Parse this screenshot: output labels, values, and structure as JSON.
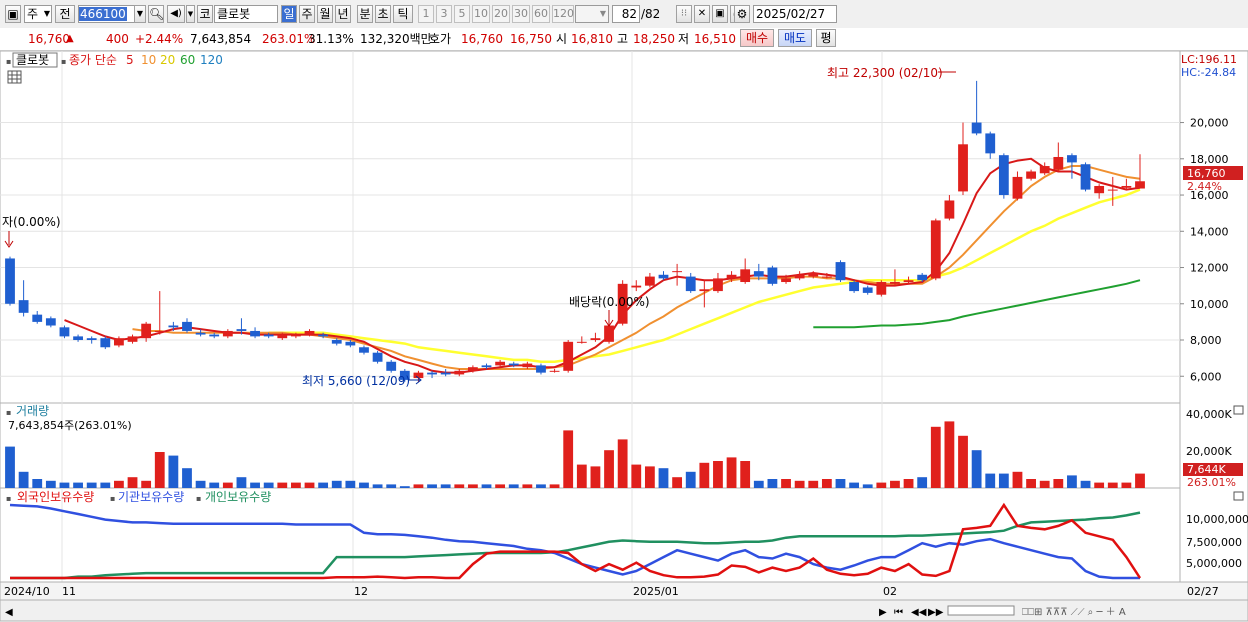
{
  "toolbar": {
    "type_select": "주",
    "prev_label": "전",
    "code_input": "466100",
    "market_label": "코",
    "stock_name": "클로봇",
    "periods": [
      "일",
      "주",
      "월",
      "년",
      "분",
      "초",
      "틱"
    ],
    "intervals": [
      "1",
      "3",
      "5",
      "10",
      "20",
      "30",
      "60",
      "120"
    ],
    "count_display": "82",
    "count_total": "/82",
    "date_value": "2025/02/27"
  },
  "quote": {
    "price": "16,760",
    "change": "400",
    "change_pct": "+2.44%",
    "volume": "7,643,854",
    "volume_ratio": "263.01%",
    "turnover": "31.13%",
    "amount": "132,320백만",
    "bid_label": "호가",
    "ask": "16,760",
    "bid": "16,750",
    "open_label": "시",
    "open": "16,810",
    "high_label": "고",
    "high": "18,250",
    "low_label": "저",
    "low": "16,510",
    "buy_btn": "매수",
    "sell_btn": "매도",
    "eval_btn": "평"
  },
  "legend": {
    "name": "클로봇",
    "ma_prefix": "종가 단순",
    "ma5": "5",
    "ma10": "10",
    "ma20": "20",
    "ma60": "60",
    "ma120": "120"
  },
  "annotations": {
    "high_note": "최고 22,300 (02/10)",
    "low_note": "최저 5,660 (12/09)",
    "dividend_note": "배당락(0.00%)",
    "left_note": "자(0.00%)",
    "lc": "LC:196.11",
    "hc": "HC:-24.84",
    "price_tag": "16,760",
    "pct_tag": "2.44%"
  },
  "price_axis": [
    "20,000",
    "18,000",
    "16,000",
    "14,000",
    "12,000",
    "10,000",
    "8,000",
    "6,000"
  ],
  "volume_panel": {
    "title": "거래량",
    "value": "7,643,854주(263.01%)",
    "axis": [
      "40,000K",
      "20,000K"
    ],
    "tag": "7,644K",
    "tag_pct": "263.01%"
  },
  "holding_panel": {
    "foreign": "외국인보유수량",
    "institution": "기관보유수량",
    "individual": "개인보유수량",
    "axis": [
      "10,000,000",
      "7,500,000",
      "5,000,000"
    ]
  },
  "date_axis": [
    "2024/10",
    "11",
    "12",
    "2025/01",
    "02"
  ],
  "date_end": "02/27",
  "colors": {
    "up": "#e0201c",
    "down": "#1f5fd0",
    "ma5": "#d81818",
    "ma10": "#f09030",
    "ma20": "#ffff30",
    "ma60": "#20a030",
    "foreign": "#e01010",
    "institution": "#3050e0",
    "individual": "#209060"
  },
  "chart_data": {
    "type": "candlestick",
    "ylim": [
      4800,
      22900
    ],
    "candles": [
      [
        12500,
        10000,
        9900,
        12600
      ],
      [
        10200,
        9500,
        9300,
        11300
      ],
      [
        9400,
        9000,
        8900,
        9600
      ],
      [
        9200,
        8800,
        8700,
        9300
      ],
      [
        8700,
        8200,
        8100,
        8800
      ],
      [
        8200,
        8000,
        7900,
        8300
      ],
      [
        8100,
        8000,
        7800,
        8200
      ],
      [
        8100,
        7600,
        7500,
        8200
      ],
      [
        7700,
        8100,
        7600,
        8200
      ],
      [
        7900,
        8200,
        7800,
        8300
      ],
      [
        8100,
        8900,
        7900,
        9000
      ],
      [
        8500,
        8500,
        8300,
        10700
      ],
      [
        8800,
        8700,
        8500,
        9000
      ],
      [
        9000,
        8500,
        8400,
        9200
      ],
      [
        8400,
        8300,
        8200,
        8600
      ],
      [
        8300,
        8200,
        8100,
        8400
      ],
      [
        8200,
        8500,
        8100,
        8600
      ],
      [
        8600,
        8500,
        8300,
        9200
      ],
      [
        8500,
        8200,
        8100,
        8700
      ],
      [
        8300,
        8200,
        8100,
        8400
      ],
      [
        8100,
        8300,
        8000,
        8400
      ],
      [
        8200,
        8300,
        8100,
        8400
      ],
      [
        8300,
        8500,
        8200,
        8600
      ],
      [
        8300,
        8200,
        8100,
        8400
      ],
      [
        8000,
        7800,
        7700,
        8100
      ],
      [
        7900,
        7700,
        7600,
        8000
      ],
      [
        7600,
        7300,
        7200,
        7700
      ],
      [
        7300,
        6800,
        6700,
        7400
      ],
      [
        6800,
        6300,
        6200,
        6900
      ],
      [
        6300,
        5800,
        5700,
        6400
      ],
      [
        5900,
        6200,
        5660,
        6300
      ],
      [
        6200,
        6100,
        5900,
        6300
      ],
      [
        6200,
        6100,
        6000,
        6400
      ],
      [
        6100,
        6300,
        6000,
        6400
      ],
      [
        6300,
        6500,
        6200,
        6600
      ],
      [
        6600,
        6500,
        6400,
        6700
      ],
      [
        6600,
        6800,
        6500,
        6900
      ],
      [
        6700,
        6600,
        6500,
        6800
      ],
      [
        6500,
        6700,
        6400,
        6800
      ],
      [
        6600,
        6200,
        6100,
        6700
      ],
      [
        6300,
        6300,
        6200,
        6400
      ],
      [
        6300,
        7900,
        6200,
        8000
      ],
      [
        7900,
        7900,
        7800,
        8200
      ],
      [
        8000,
        8100,
        7900,
        8400
      ],
      [
        7900,
        8800,
        7800,
        8900
      ],
      [
        8900,
        11100,
        8800,
        11300
      ],
      [
        10900,
        11000,
        10700,
        11300
      ],
      [
        11000,
        11500,
        10900,
        11700
      ],
      [
        11600,
        11400,
        11300,
        11800
      ],
      [
        11800,
        11800,
        11000,
        12200
      ],
      [
        11500,
        10700,
        10600,
        11700
      ],
      [
        10700,
        10800,
        9800,
        11300
      ],
      [
        10700,
        11400,
        10600,
        11700
      ],
      [
        11400,
        11600,
        11200,
        11800
      ],
      [
        11200,
        11900,
        11100,
        12500
      ],
      [
        11800,
        11500,
        11300,
        12200
      ],
      [
        12000,
        11100,
        11000,
        12100
      ],
      [
        11200,
        11400,
        11100,
        11600
      ],
      [
        11400,
        11600,
        11300,
        11800
      ],
      [
        11500,
        11700,
        11400,
        11800
      ],
      [
        11500,
        11500,
        11400,
        11700
      ],
      [
        12300,
        11300,
        11200,
        12400
      ],
      [
        11200,
        10700,
        10600,
        11300
      ],
      [
        10900,
        10600,
        10500,
        11000
      ],
      [
        10500,
        11200,
        10400,
        11300
      ],
      [
        11100,
        11200,
        11000,
        11900
      ],
      [
        11200,
        11300,
        11100,
        11500
      ],
      [
        11600,
        11300,
        11200,
        11700
      ],
      [
        11400,
        14600,
        11300,
        14700
      ],
      [
        14700,
        15700,
        14600,
        16000
      ],
      [
        16200,
        18800,
        16000,
        20000
      ],
      [
        20000,
        19400,
        19300,
        22300
      ],
      [
        19400,
        18300,
        18000,
        19500
      ],
      [
        18200,
        16000,
        15800,
        18300
      ],
      [
        15800,
        17000,
        15700,
        17300
      ],
      [
        16900,
        17300,
        16800,
        17400
      ],
      [
        17200,
        17600,
        17100,
        17800
      ],
      [
        17400,
        18100,
        17300,
        18900
      ],
      [
        18200,
        17800,
        16900,
        18300
      ],
      [
        17700,
        16300,
        16200,
        17800
      ],
      [
        16100,
        16500,
        15800,
        16600
      ],
      [
        16300,
        16300,
        15400,
        17000
      ],
      [
        16400,
        16500,
        16300,
        16900
      ],
      [
        16360,
        16760,
        16510,
        18250
      ]
    ],
    "ma5": [
      null,
      null,
      null,
      null,
      9100,
      8800,
      8500,
      8200,
      8000,
      8100,
      8200,
      8400,
      8600,
      8700,
      8600,
      8500,
      8400,
      8400,
      8300,
      8300,
      8300,
      8300,
      8300,
      8300,
      8200,
      8100,
      7900,
      7500,
      7100,
      6800,
      6600,
      6300,
      6200,
      6200,
      6300,
      6400,
      6500,
      6600,
      6600,
      6500,
      6500,
      6800,
      7200,
      7600,
      8200,
      9400,
      10200,
      10800,
      11300,
      11500,
      11400,
      11300,
      11300,
      11400,
      11500,
      11600,
      11500,
      11500,
      11600,
      11700,
      11600,
      11500,
      11300,
      11100,
      11000,
      11000,
      11100,
      11200,
      11800,
      12800,
      14400,
      16100,
      17200,
      17700,
      17900,
      18000,
      17500,
      17300,
      17300,
      17000,
      16700,
      16500,
      16300,
      16400
    ],
    "ma10": [
      null,
      null,
      null,
      null,
      null,
      null,
      null,
      null,
      null,
      8600,
      8500,
      8500,
      8400,
      8400,
      8400,
      8400,
      8400,
      8400,
      8400,
      8400,
      8400,
      8300,
      8300,
      8200,
      8100,
      8000,
      7800,
      7600,
      7400,
      7100,
      6900,
      6700,
      6500,
      6400,
      6400,
      6400,
      6400,
      6400,
      6400,
      6400,
      6500,
      6600,
      6900,
      7200,
      7600,
      8000,
      8400,
      8900,
      9300,
      9800,
      10200,
      10600,
      11000,
      11300,
      11400,
      11400,
      11400,
      11400,
      11500,
      11500,
      11400,
      11400,
      11300,
      11200,
      11100,
      11100,
      11100,
      11100,
      11500,
      12000,
      12700,
      13500,
      14300,
      15100,
      15800,
      16500,
      17000,
      17400,
      17600,
      17600,
      17400,
      17200,
      17000,
      16900
    ],
    "ma20": [
      null,
      null,
      null,
      null,
      null,
      null,
      null,
      null,
      null,
      null,
      null,
      null,
      null,
      null,
      null,
      null,
      null,
      null,
      null,
      8400,
      8400,
      8400,
      8400,
      8400,
      8300,
      8200,
      8100,
      8000,
      7900,
      7800,
      7600,
      7500,
      7400,
      7300,
      7200,
      7100,
      7000,
      6900,
      6900,
      6800,
      6800,
      6900,
      7000,
      7100,
      7200,
      7400,
      7600,
      7800,
      8000,
      8300,
      8600,
      8900,
      9200,
      9500,
      9800,
      10100,
      10300,
      10500,
      10700,
      10900,
      11000,
      11100,
      11200,
      11300,
      11300,
      11300,
      11300,
      11300,
      11500,
      11700,
      12000,
      12400,
      12800,
      13200,
      13600,
      14000,
      14300,
      14700,
      15000,
      15300,
      15600,
      15800,
      16000,
      16300
    ],
    "ma60": [
      null,
      null,
      null,
      null,
      null,
      null,
      null,
      null,
      null,
      null,
      null,
      null,
      null,
      null,
      null,
      null,
      null,
      null,
      null,
      null,
      null,
      null,
      null,
      null,
      null,
      null,
      null,
      null,
      null,
      null,
      null,
      null,
      null,
      null,
      null,
      null,
      null,
      null,
      null,
      null,
      null,
      null,
      null,
      null,
      null,
      null,
      null,
      null,
      null,
      null,
      null,
      null,
      null,
      null,
      null,
      null,
      null,
      null,
      null,
      8700,
      8700,
      8700,
      8700,
      8750,
      8800,
      8800,
      8850,
      8900,
      9000,
      9100,
      9300,
      9450,
      9600,
      9750,
      9900,
      10050,
      10200,
      10350,
      10500,
      10650,
      10800,
      10950,
      11100,
      11300
    ],
    "volume": [
      23,
      9,
      5,
      4,
      3,
      3,
      3,
      3,
      4,
      6,
      4,
      20,
      18,
      11,
      4,
      3,
      3,
      6,
      3,
      3,
      3,
      3,
      3,
      3,
      4,
      4,
      3,
      2,
      2,
      1,
      2,
      2,
      2,
      2,
      2,
      2,
      2,
      2,
      2,
      2,
      2,
      32,
      13,
      12,
      21,
      27,
      13,
      12,
      11,
      6,
      9,
      14,
      15,
      17,
      15,
      4,
      5,
      5,
      4,
      4,
      5,
      5,
      3,
      2,
      3,
      4,
      5,
      6,
      34,
      37,
      29,
      21,
      8,
      8,
      9,
      5,
      4,
      5,
      7,
      4,
      3,
      3,
      3,
      8
    ],
    "foreign": [
      2.0,
      2.0,
      2.0,
      2.0,
      2.0,
      2.0,
      2.0,
      2.0,
      2.0,
      2.0,
      2.0,
      2.0,
      2.0,
      2.0,
      2.0,
      2.0,
      2.0,
      2.0,
      2.0,
      2.0,
      2.0,
      2.0,
      2.0,
      2.0,
      2.1,
      2.1,
      2.1,
      2.2,
      2.1,
      2.0,
      2.1,
      2.1,
      2.0,
      2.0,
      4.0,
      5.5,
      5.8,
      5.8,
      5.8,
      5.8,
      5.8,
      5.6,
      4.0,
      3.0,
      4.0,
      3.2,
      4.2,
      3.0,
      2.4,
      2.1,
      2.1,
      2.2,
      2.5,
      3.8,
      3.6,
      2.8,
      3.5,
      3.0,
      3.5,
      4.8,
      3.2,
      2.6,
      2.4,
      2.6,
      3.5,
      3.0,
      4.0,
      2.5,
      2.3,
      3.0,
      9.0,
      9.2,
      9.5,
      12.5,
      9.5,
      9.2,
      9.0,
      9.5,
      10.3,
      8.5,
      8.0,
      7.5,
      5.0,
      2.0
    ],
    "institution": [
      12.5,
      12.4,
      12.3,
      12.0,
      11.6,
      11.2,
      10.8,
      10.4,
      10.2,
      10.0,
      10.0,
      9.9,
      9.8,
      9.8,
      9.8,
      9.8,
      9.8,
      9.8,
      9.8,
      9.8,
      9.8,
      9.7,
      9.7,
      9.7,
      9.7,
      9.7,
      8.5,
      8.3,
      8.3,
      8.2,
      8.0,
      7.8,
      7.5,
      7.3,
      7.2,
      7.0,
      6.8,
      6.6,
      6.2,
      6.0,
      5.6,
      4.8,
      4.0,
      3.5,
      3.0,
      2.5,
      3.0,
      4.0,
      5.0,
      6.0,
      5.5,
      5.0,
      4.5,
      5.5,
      6.0,
      5.0,
      4.8,
      5.5,
      5.0,
      4.0,
      3.5,
      3.2,
      3.8,
      4.5,
      5.0,
      5.0,
      6.0,
      7.0,
      6.5,
      7.0,
      6.8,
      7.3,
      7.6,
      7.0,
      6.5,
      6.0,
      5.5,
      5.0,
      4.8,
      3.0,
      2.2,
      2.0,
      2.0,
      2.0
    ],
    "individual": [
      2.0,
      2.0,
      2.0,
      2.0,
      2.0,
      2.2,
      2.2,
      2.4,
      2.5,
      2.6,
      2.7,
      2.7,
      2.7,
      2.7,
      2.7,
      2.7,
      2.7,
      2.7,
      2.7,
      2.7,
      2.7,
      2.7,
      2.7,
      2.7,
      5.0,
      5.0,
      5.0,
      5.0,
      5.0,
      5.0,
      5.1,
      5.2,
      5.3,
      5.4,
      5.5,
      5.6,
      5.6,
      5.6,
      5.6,
      5.6,
      5.7,
      6.0,
      6.4,
      6.8,
      7.2,
      7.4,
      7.3,
      7.2,
      7.2,
      7.2,
      7.1,
      7.0,
      7.0,
      7.1,
      7.2,
      7.2,
      7.4,
      7.8,
      8.0,
      8.0,
      8.0,
      8.0,
      8.0,
      8.0,
      8.0,
      8.0,
      8.1,
      8.1,
      8.2,
      8.3,
      8.4,
      8.5,
      8.6,
      8.8,
      9.5,
      10.0,
      10.1,
      10.2,
      10.3,
      10.4,
      10.6,
      10.7,
      11.0,
      11.4
    ]
  }
}
